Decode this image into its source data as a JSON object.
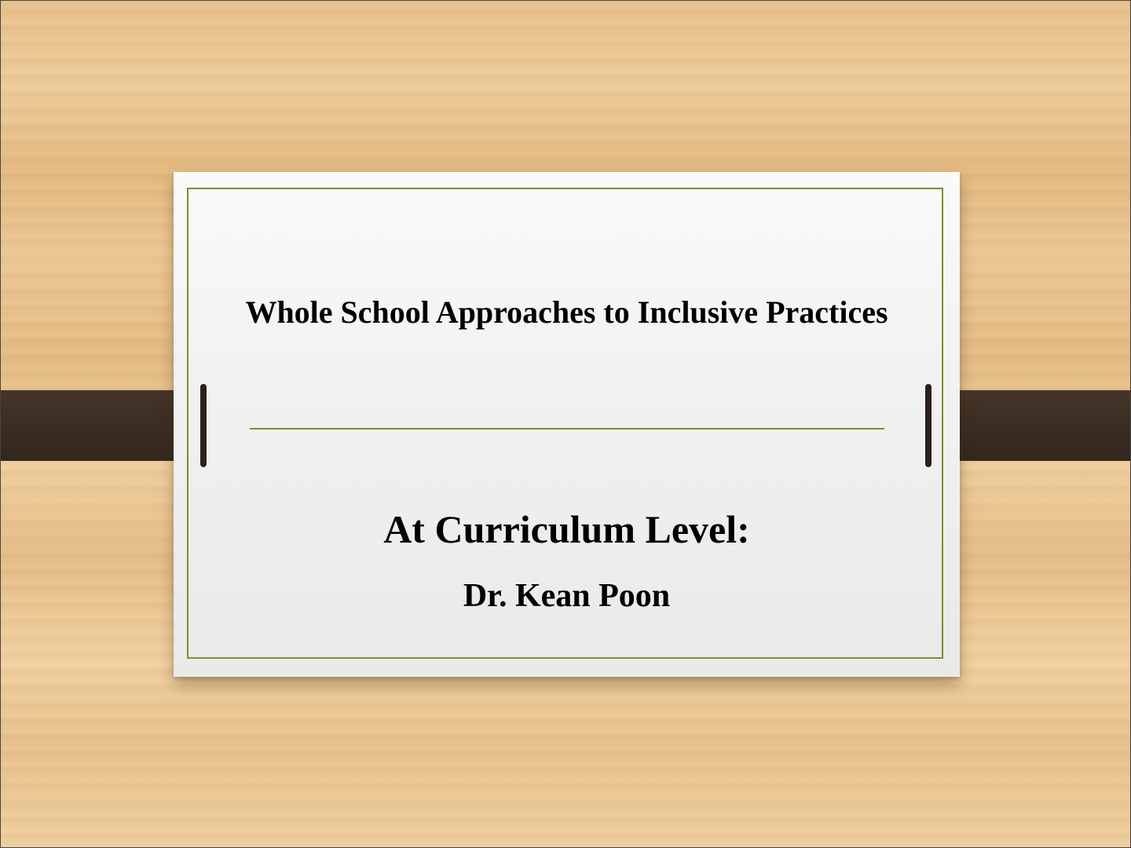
{
  "slide": {
    "title": "Whole School Approaches to Inclusive Practices",
    "subtitle": "At Curriculum Level:",
    "author": "Dr. Kean Poon"
  },
  "colors": {
    "frame_accent": "#7d8f2a",
    "strap": "#3a2d22",
    "wood_background": "#e7c08a",
    "card": "#f3f3f3"
  }
}
